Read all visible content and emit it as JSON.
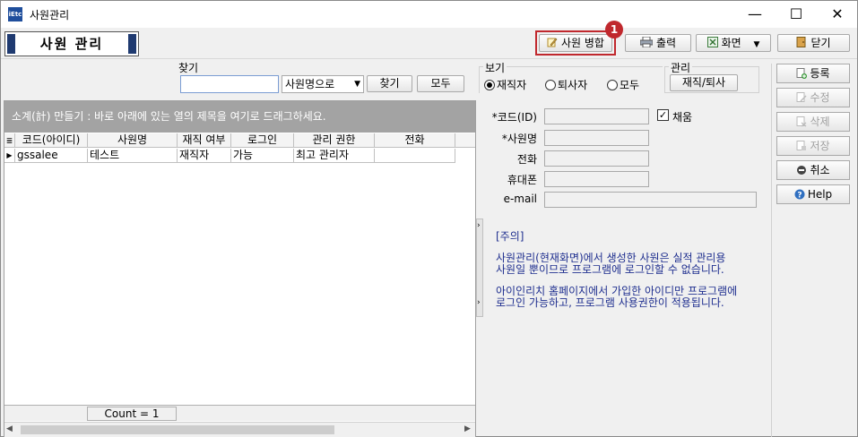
{
  "window": {
    "title": "사원관리",
    "app_icon_text": "iEtc",
    "controls": [
      "—",
      "☐",
      "✕"
    ]
  },
  "header": {
    "title": "사원 관리"
  },
  "toolbar": {
    "merge_label": "사원 병합",
    "print_label": "출력",
    "screen_label": "화면",
    "close_label": "닫기",
    "badge": "1"
  },
  "search": {
    "group_label": "찾기",
    "value": "",
    "mode_selected": "사원명으로",
    "find_label": "찾기",
    "all_label": "모두"
  },
  "view": {
    "group_label": "보기",
    "options": [
      "재직자",
      "퇴사자",
      "모두"
    ],
    "selected": "재직자"
  },
  "manage": {
    "group_label": "관리",
    "button_label": "재직/퇴사"
  },
  "grid": {
    "group_hint": "소계(計) 만들기 : 바로 아래에 있는 열의 제목을 여기로 드래그하세요.",
    "columns": [
      "코드(아이디)",
      "사원명",
      "재직 여부",
      "로그인",
      "관리 권한",
      "전화"
    ],
    "rows": [
      [
        "gssalee",
        "테스트",
        "재직자",
        "가능",
        "최고 관리자",
        ""
      ]
    ],
    "footer": "Count = 1"
  },
  "form": {
    "code_label": "*코드(ID)",
    "auto_label": "채움",
    "auto_checked": true,
    "name_label": "*사원명",
    "phone_label": "전화",
    "mobile_label": "휴대폰",
    "email_label": "e-mail"
  },
  "notice": {
    "title": "[주의]",
    "line1": "사원관리(현재화면)에서 생성한 사원은 실적 관리용",
    "line2": "사원일 뿐이므로 프로그램에 로그인할 수 없습니다.",
    "line3": "아이인리치 홈페이지에서 가입한 아이디만 프로그램에",
    "line4": "로그인 가능하고, 프로그램 사용권한이 적용됩니다."
  },
  "side": {
    "register_label": "등록",
    "edit_label": "수정",
    "delete_label": "삭제",
    "save_label": "저장",
    "cancel_label": "취소",
    "help_label": "Help"
  },
  "colors": {
    "accent_blue": "#1f3a70",
    "highlight_red": "#c0282d",
    "notice_text": "#1f2f8f",
    "group_bar": "#a3a3a3"
  }
}
